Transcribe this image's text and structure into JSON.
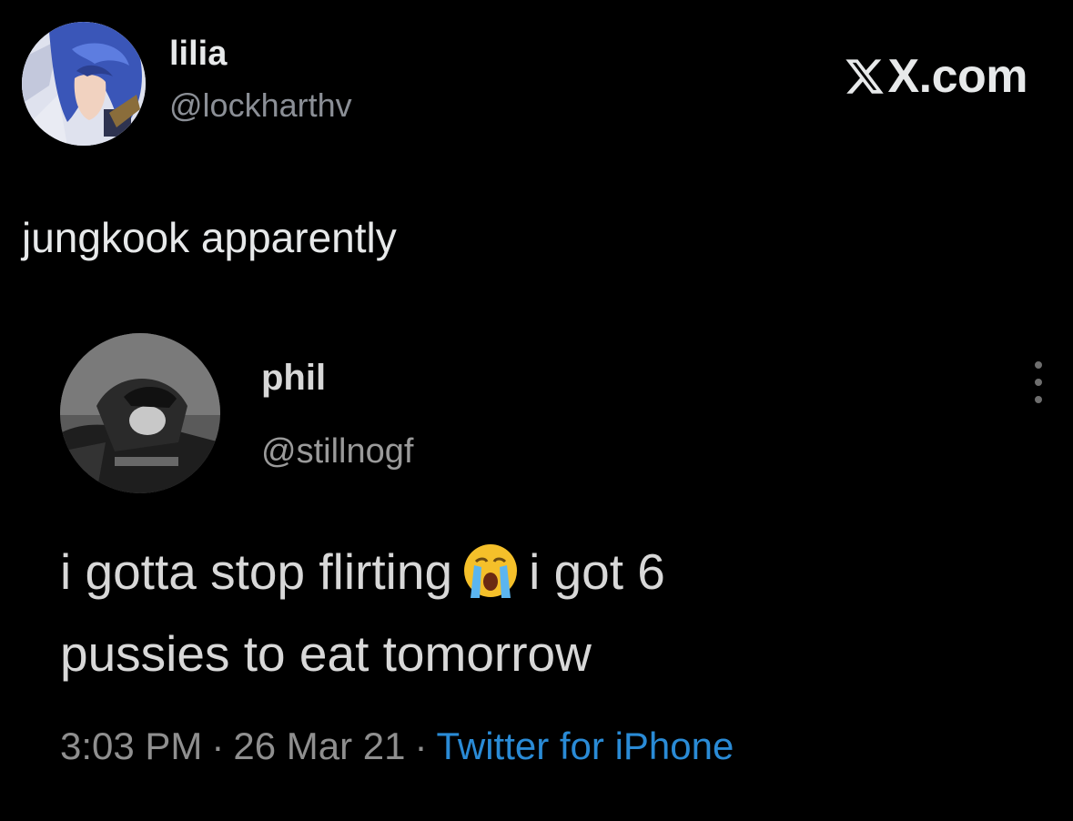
{
  "post": {
    "author": {
      "name": "lilia",
      "handle": "@lockharthv"
    },
    "brand": {
      "text": "X.com",
      "icon": "x-logo-icon"
    },
    "text": "jungkook apparently"
  },
  "quoted_tweet": {
    "author": {
      "name": "phil",
      "handle": "@stillnogf"
    },
    "more_icon": "more-vertical-icon",
    "text_line1_a": "i gotta stop flirting",
    "emoji": "loudly-crying-face-icon",
    "text_line1_b": "i got 6",
    "text_line2": "pussies to eat tomorrow",
    "time": "3:03 PM",
    "date": "26 Mar 21",
    "separator": "·",
    "source": "Twitter for iPhone"
  },
  "colors": {
    "background": "#000000",
    "primary_text": "#e7e9ea",
    "secondary_text": "#8b8f96",
    "link": "#2a8bd6"
  }
}
